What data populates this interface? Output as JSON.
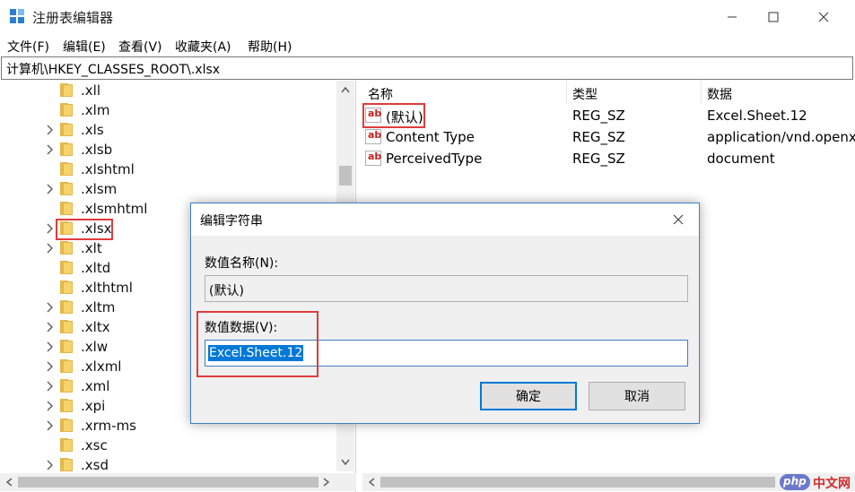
{
  "window": {
    "title": "注册表编辑器",
    "menu": [
      "文件(F)",
      "编辑(E)",
      "查看(V)",
      "收藏夹(A)",
      "帮助(H)"
    ],
    "address": "计算机\\HKEY_CLASSES_ROOT\\.xlsx"
  },
  "tree": {
    "items": [
      {
        "label": ".xll",
        "expandable": false
      },
      {
        "label": ".xlm",
        "expandable": false
      },
      {
        "label": ".xls",
        "expandable": true
      },
      {
        "label": ".xlsb",
        "expandable": true
      },
      {
        "label": ".xlshtml",
        "expandable": false
      },
      {
        "label": ".xlsm",
        "expandable": true
      },
      {
        "label": ".xlsmhtml",
        "expandable": false
      },
      {
        "label": ".xlsx",
        "expandable": true,
        "selected": true
      },
      {
        "label": ".xlt",
        "expandable": true
      },
      {
        "label": ".xltd",
        "expandable": false
      },
      {
        "label": ".xlthtml",
        "expandable": false
      },
      {
        "label": ".xltm",
        "expandable": true
      },
      {
        "label": ".xltx",
        "expandable": true
      },
      {
        "label": ".xlw",
        "expandable": true
      },
      {
        "label": ".xlxml",
        "expandable": true
      },
      {
        "label": ".xml",
        "expandable": true
      },
      {
        "label": ".xpi",
        "expandable": true
      },
      {
        "label": ".xrm-ms",
        "expandable": true
      },
      {
        "label": ".xsc",
        "expandable": false
      },
      {
        "label": ".xsd",
        "expandable": true
      }
    ]
  },
  "listview": {
    "columns": [
      "名称",
      "类型",
      "数据"
    ],
    "rows": [
      {
        "name": "(默认)",
        "type": "REG_SZ",
        "data": "Excel.Sheet.12"
      },
      {
        "name": "Content Type",
        "type": "REG_SZ",
        "data": "application/vnd.openx"
      },
      {
        "name": "PerceivedType",
        "type": "REG_SZ",
        "data": "document"
      }
    ],
    "icon_text": "ab"
  },
  "dialog": {
    "title": "编辑字符串",
    "name_label": "数值名称(N):",
    "name_value": "(默认)",
    "data_label": "数值数据(V):",
    "data_value": "Excel.Sheet.12",
    "ok": "确定",
    "cancel": "取消"
  },
  "watermark": {
    "logo": "php",
    "text": "中文网"
  },
  "colors": {
    "highlight": "#e03c3c",
    "selection": "#0078d7",
    "folder": "#f6d36b"
  }
}
